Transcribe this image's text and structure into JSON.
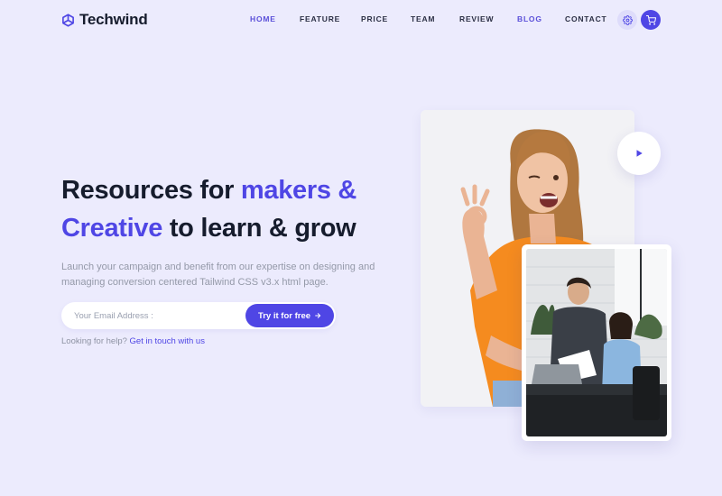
{
  "brand": {
    "name": "Techwind"
  },
  "nav": {
    "items": [
      {
        "label": "HOME",
        "active": true
      },
      {
        "label": "FEATURE",
        "active": false
      },
      {
        "label": "PRICE",
        "active": false
      },
      {
        "label": "TEAM",
        "active": false
      },
      {
        "label": "REVIEW",
        "active": false
      },
      {
        "label": "BLOG",
        "active": true
      },
      {
        "label": "CONTACT",
        "active": false
      }
    ],
    "icons": {
      "settings": "gear-icon",
      "cart": "shopping-cart-icon"
    }
  },
  "hero": {
    "title_part1": "Resources for ",
    "title_accent1": "makers &",
    "title_accent2": "Creative",
    "title_part2": " to learn & grow",
    "description": "Launch your campaign and benefit from our expertise on designing and managing conversion centered Tailwind CSS v3.x html page.",
    "email_placeholder": "Your Email Address :",
    "cta_label": "Try it for free",
    "cta_icon": "arrow-right-icon",
    "help_text": "Looking for help?",
    "help_link": "Get in touch with us",
    "play_icon": "play-icon"
  },
  "colors": {
    "background": "#ecebfd",
    "accent": "#4f46e5",
    "text_dark": "#161c2d",
    "text_muted": "#9499a8"
  }
}
